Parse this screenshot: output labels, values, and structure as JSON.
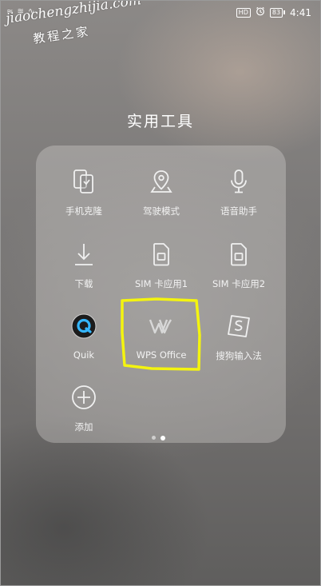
{
  "status_bar": {
    "left_text": "≈ ≋ ∿",
    "network_badge": "HD",
    "alarm_icon": "alarm-clock-icon",
    "battery_level": "83",
    "time": "4:41"
  },
  "watermark": {
    "latin": "jiaochengzhijia.com",
    "chinese": "教程之家"
  },
  "folder": {
    "title": "实用工具",
    "apps": [
      {
        "label": "手机克隆",
        "icon": "phone-clone-icon"
      },
      {
        "label": "驾驶模式",
        "icon": "location-pin-icon"
      },
      {
        "label": "语音助手",
        "icon": "microphone-icon"
      },
      {
        "label": "下载",
        "icon": "download-icon"
      },
      {
        "label": "SIM 卡应用1",
        "icon": "sim-card-icon"
      },
      {
        "label": "SIM 卡应用2",
        "icon": "sim-card-icon"
      },
      {
        "label": "Quik",
        "icon": "quik-icon"
      },
      {
        "label": "WPS Office",
        "icon": "wps-office-icon"
      },
      {
        "label": "搜狗输入法",
        "icon": "sogou-input-icon"
      },
      {
        "label": "添加",
        "icon": "add-circle-icon"
      }
    ],
    "page_count": 2,
    "active_page": 2
  },
  "colors": {
    "icon_stroke": "#f0f0f0",
    "highlight": "#f4f40f"
  }
}
